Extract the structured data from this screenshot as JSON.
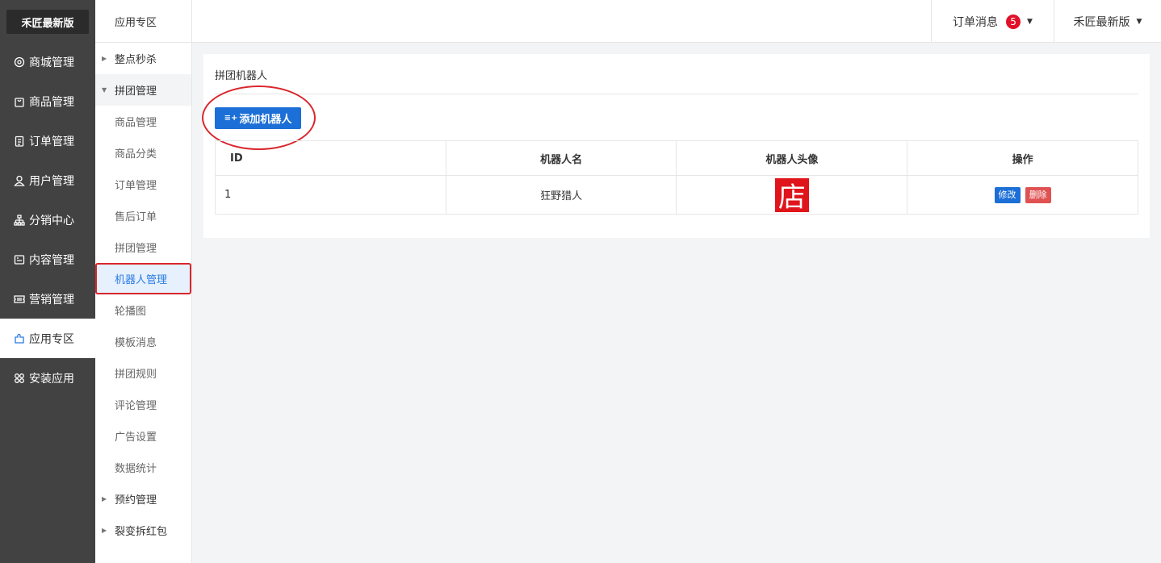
{
  "brand": "禾匠最新版",
  "nav": [
    {
      "label": "商城管理",
      "icon": "gear-icon"
    },
    {
      "label": "商品管理",
      "icon": "bag-icon"
    },
    {
      "label": "订单管理",
      "icon": "clipboard-icon"
    },
    {
      "label": "用户管理",
      "icon": "user-icon"
    },
    {
      "label": "分销中心",
      "icon": "hierarchy-icon"
    },
    {
      "label": "内容管理",
      "icon": "content-icon"
    },
    {
      "label": "营销管理",
      "icon": "ticket-icon"
    },
    {
      "label": "应用专区",
      "icon": "puzzle-icon"
    },
    {
      "label": "安装应用",
      "icon": "grid-icon"
    }
  ],
  "submenu": {
    "title": "应用专区",
    "groups": [
      {
        "label": "整点秒杀"
      },
      {
        "label": "拼团管理"
      },
      {
        "label": "预约管理"
      },
      {
        "label": "裂变拆红包"
      }
    ],
    "items": [
      "商品管理",
      "商品分类",
      "订单管理",
      "售后订单",
      "拼团管理",
      "机器人管理",
      "轮播图",
      "模板消息",
      "拼团规则",
      "评论管理",
      "广告设置",
      "数据统计"
    ]
  },
  "header": {
    "messages_label": "订单消息",
    "messages_count": "5",
    "user_label": "禾匠最新版"
  },
  "panel": {
    "title": "拼团机器人",
    "add_button": "添加机器人"
  },
  "table": {
    "headers": [
      "ID",
      "机器人名",
      "机器人头像",
      "操作"
    ],
    "rows": [
      {
        "id": "1",
        "name": "狂野猎人",
        "avatar_text": "店",
        "edit": "修改",
        "delete": "删除"
      }
    ]
  },
  "colors": {
    "sidebar": "#424242",
    "accent": "#1c6fd6",
    "danger": "#e05252",
    "badge": "#e0122a",
    "highlight_outline": "#d9262c"
  }
}
